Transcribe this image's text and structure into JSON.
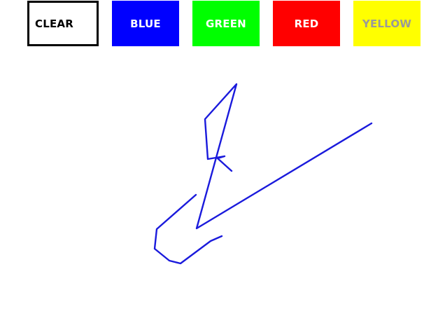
{
  "toolbar": {
    "clear_label": "CLEAR",
    "blue_label": "BLUE",
    "green_label": "GREEN",
    "red_label": "RED",
    "yellow_label": "YELLOW"
  },
  "colors": {
    "blue": "#0000ff",
    "green": "#00ff00",
    "red": "#ff0000",
    "yellow": "#ffff00",
    "stroke": "#1a1adc"
  }
}
